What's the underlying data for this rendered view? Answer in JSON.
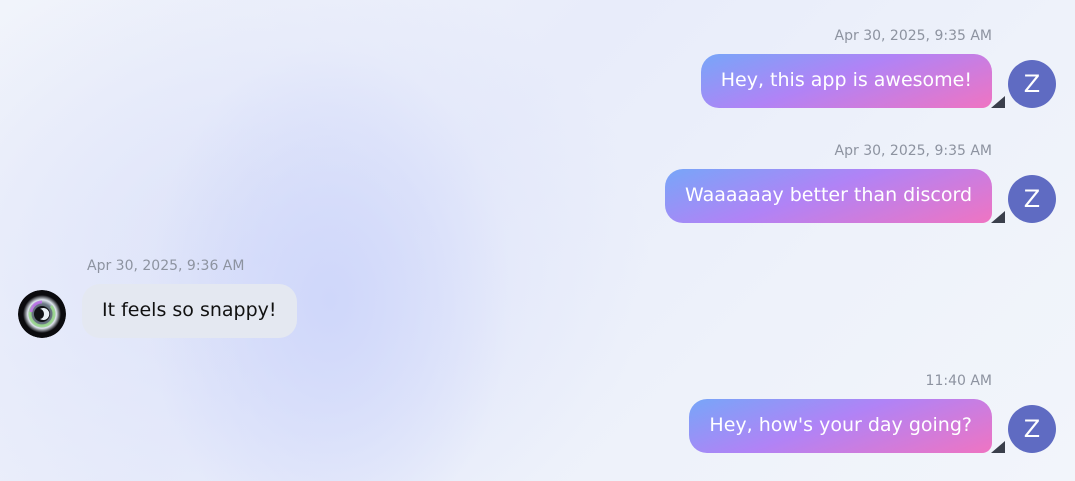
{
  "colors": {
    "outgoing_gradient": [
      "#77a6f8",
      "#b083f6",
      "#ef74c2"
    ],
    "incoming_bubble": "#e4e8f1",
    "avatar_bg": "#5f6bc2",
    "timestamp": "#8d93a0"
  },
  "messages": [
    {
      "direction": "outgoing",
      "timestamp": "Apr 30, 2025, 9:35 AM",
      "text": "Hey, this app is awesome!",
      "avatar_initial": "Z"
    },
    {
      "direction": "outgoing",
      "timestamp": "Apr 30, 2025, 9:35 AM",
      "text": "Waaaaaay better than discord",
      "avatar_initial": "Z"
    },
    {
      "direction": "incoming",
      "timestamp": "Apr 30, 2025, 9:36 AM",
      "text": "It feels so snappy!",
      "avatar_icon": "user-avatar-image"
    },
    {
      "direction": "outgoing",
      "timestamp": "11:40 AM",
      "text": "Hey, how's your day going?",
      "avatar_initial": "Z"
    }
  ]
}
